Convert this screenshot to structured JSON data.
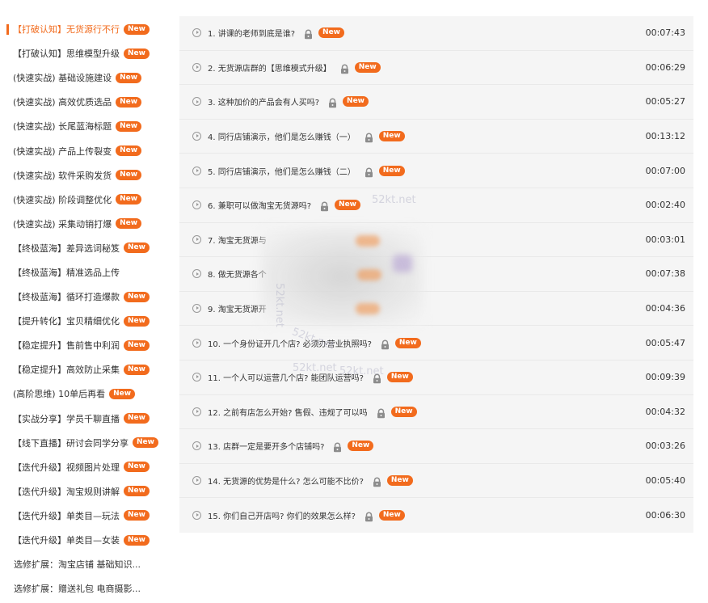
{
  "badge_text": "New",
  "accent_color": "#f26b1d",
  "sidebar": {
    "items": [
      {
        "label": "【打破认知】无货源行不行",
        "new": true,
        "active": true
      },
      {
        "label": "【打破认知】思维模型升级",
        "new": true
      },
      {
        "label": "(快速实战) 基础设施建设",
        "new": true
      },
      {
        "label": "(快速实战) 高效优质选品",
        "new": true
      },
      {
        "label": "(快速实战) 长尾蓝海标题",
        "new": true
      },
      {
        "label": "(快速实战) 产品上传裂变",
        "new": true
      },
      {
        "label": "(快速实战) 软件采购发货",
        "new": true
      },
      {
        "label": "(快速实战) 阶段调整优化",
        "new": true
      },
      {
        "label": "(快速实战) 采集动销打爆",
        "new": true
      },
      {
        "label": "【终极蓝海】差异选词秘笈",
        "new": true
      },
      {
        "label": "【终极蓝海】精准选品上传",
        "new": false
      },
      {
        "label": "【终极蓝海】循环打造爆款",
        "new": true
      },
      {
        "label": "【提升转化】宝贝精细优化",
        "new": true
      },
      {
        "label": "【稳定提升】售前售中利润",
        "new": true
      },
      {
        "label": "【稳定提升】高效防止采集",
        "new": true
      },
      {
        "label": "(高阶思维) 10单后再看",
        "new": true
      },
      {
        "label": "【实战分享】学员千聊直播",
        "new": true
      },
      {
        "label": "【线下直播】研讨会同学分享",
        "new": true
      },
      {
        "label": "【迭代升级】视频图片处理",
        "new": true
      },
      {
        "label": "【迭代升级】淘宝规则讲解",
        "new": true
      },
      {
        "label": "【迭代升级】单类目—玩法",
        "new": true
      },
      {
        "label": "【迭代升级】单类目—女装",
        "new": true
      },
      {
        "label": "选修扩展：淘宝店铺 基础知识...",
        "new": false,
        "plain": true
      },
      {
        "label": "选修扩展：赠送礼包 电商摄影...",
        "new": false,
        "plain": true
      }
    ]
  },
  "lessons": [
    {
      "title": "1. 讲课的老师到底是谁?",
      "duration": "00:07:43"
    },
    {
      "title": "2. 无货源店群的【思维模式升级】",
      "duration": "00:06:29"
    },
    {
      "title": "3. 这种加价的产品会有人买吗?",
      "duration": "00:05:27"
    },
    {
      "title": "4. 同行店铺演示，他们是怎么赚钱（一）",
      "duration": "00:13:12"
    },
    {
      "title": "5. 同行店铺演示，他们是怎么赚钱（二）",
      "duration": "00:07:00"
    },
    {
      "title": "6. 兼职可以做淘宝无货源吗?",
      "duration": "00:02:40"
    },
    {
      "title": "7. 淘宝无货源与",
      "duration": "00:03:01"
    },
    {
      "title": "8. 做无货源各个",
      "duration": "00:07:38"
    },
    {
      "title": "9. 淘宝无货源开",
      "duration": "00:04:36"
    },
    {
      "title": "10. 一个身份证开几个店? 必须办营业执照吗?",
      "duration": "00:05:47"
    },
    {
      "title": "11. 一个人可以运营几个店? 能团队运营吗?",
      "duration": "00:09:39"
    },
    {
      "title": "12. 之前有店怎么开始? 售假、违规了可以吗",
      "duration": "00:04:32"
    },
    {
      "title": "13. 店群一定是要开多个店铺吗?",
      "duration": "00:03:26"
    },
    {
      "title": "14. 无货源的优势是什么? 怎么可能不比价?",
      "duration": "00:05:40"
    },
    {
      "title": "15. 你们自己开店吗? 你们的效果怎么样?",
      "duration": "00:06:30"
    }
  ],
  "watermarks": [
    "52kt.net",
    "52kt.net",
    "52kt.net",
    "52kt.net",
    "52kt.net"
  ]
}
